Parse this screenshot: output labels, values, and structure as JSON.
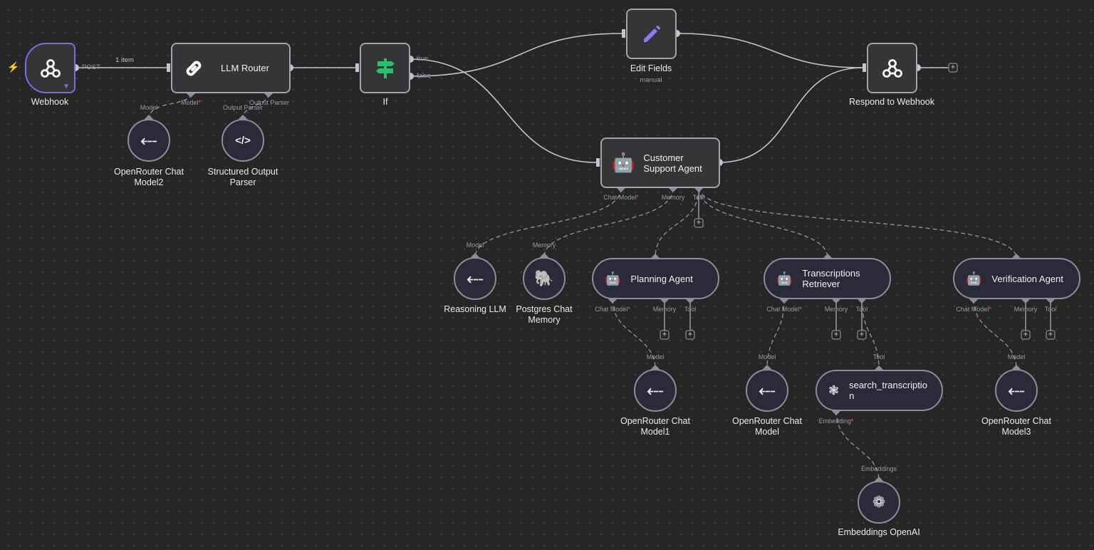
{
  "colors": {
    "canvas": "#262626",
    "node_fill": "#353538",
    "sub_node_fill": "#2a2a38",
    "trigger_border": "#7c6ed8",
    "if_icon": "#2fbd6b",
    "edit_icon": "#8b7cf6",
    "required": "#ff5a5a",
    "trigger_bolt": "#ff5a3c"
  },
  "edges": {
    "webhook_output": "POST",
    "webhook_items": "1 item",
    "if_true": "true",
    "if_false": "false"
  },
  "nodes": {
    "webhook": {
      "label": "Webhook",
      "icon": "webhook-icon"
    },
    "llm_router": {
      "label": "LLM Router",
      "icon": "link-icon",
      "ports": {
        "model": "Model",
        "output_parser": "Output Parser"
      }
    },
    "if": {
      "label": "If",
      "icon": "signpost-icon"
    },
    "edit_fields": {
      "label": "Edit Fields",
      "subtitle": "manual",
      "icon": "pencil-icon"
    },
    "respond": {
      "label": "Respond to Webhook",
      "icon": "webhook-icon"
    },
    "customer_support": {
      "label_line1": "Customer",
      "label_line2": "Support Agent",
      "icon": "robot-icon",
      "ports": {
        "chat_model": "Chat Model",
        "memory": "Memory",
        "tool": "Tool"
      }
    },
    "openrouter2": {
      "label_line1": "OpenRouter Chat",
      "label_line2": "Model2",
      "port": "Model"
    },
    "structured_parser": {
      "label_line1": "Structured Output",
      "label_line2": "Parser",
      "port": "Output Parser"
    },
    "reasoning_llm": {
      "label": "Reasoning LLM",
      "port": "Model"
    },
    "postgres_memory": {
      "label_line1": "Postgres Chat",
      "label_line2": "Memory",
      "port": "Memory"
    },
    "planning_agent": {
      "label": "Planning Agent",
      "ports": {
        "chat_model": "Chat Model",
        "memory": "Memory",
        "tool": "Tool"
      }
    },
    "transcriptions_retriever": {
      "label_line1": "Transcriptions",
      "label_line2": "Retriever",
      "ports": {
        "chat_model": "Chat Model",
        "memory": "Memory",
        "tool": "Tool"
      }
    },
    "verification_agent": {
      "label": "Verification Agent",
      "ports": {
        "chat_model": "Chat Model",
        "memory": "Memory",
        "tool": "Tool"
      }
    },
    "openrouter1": {
      "label_line1": "OpenRouter Chat",
      "label_line2": "Model1",
      "port": "Model"
    },
    "openrouter": {
      "label_line1": "OpenRouter Chat",
      "label_line2": "Model",
      "port": "Model"
    },
    "openrouter3": {
      "label_line1": "OpenRouter Chat",
      "label_line2": "Model3",
      "port": "Model"
    },
    "search_transcription": {
      "label_line1": "search_transcriptio",
      "label_line2": "n",
      "port": "Tool",
      "ports": {
        "embedding": "Embedding"
      }
    },
    "embeddings_openai": {
      "label_line1": "Embeddings OpenAI",
      "port": "Embeddings"
    }
  },
  "required_mark": "*",
  "plus": "+"
}
